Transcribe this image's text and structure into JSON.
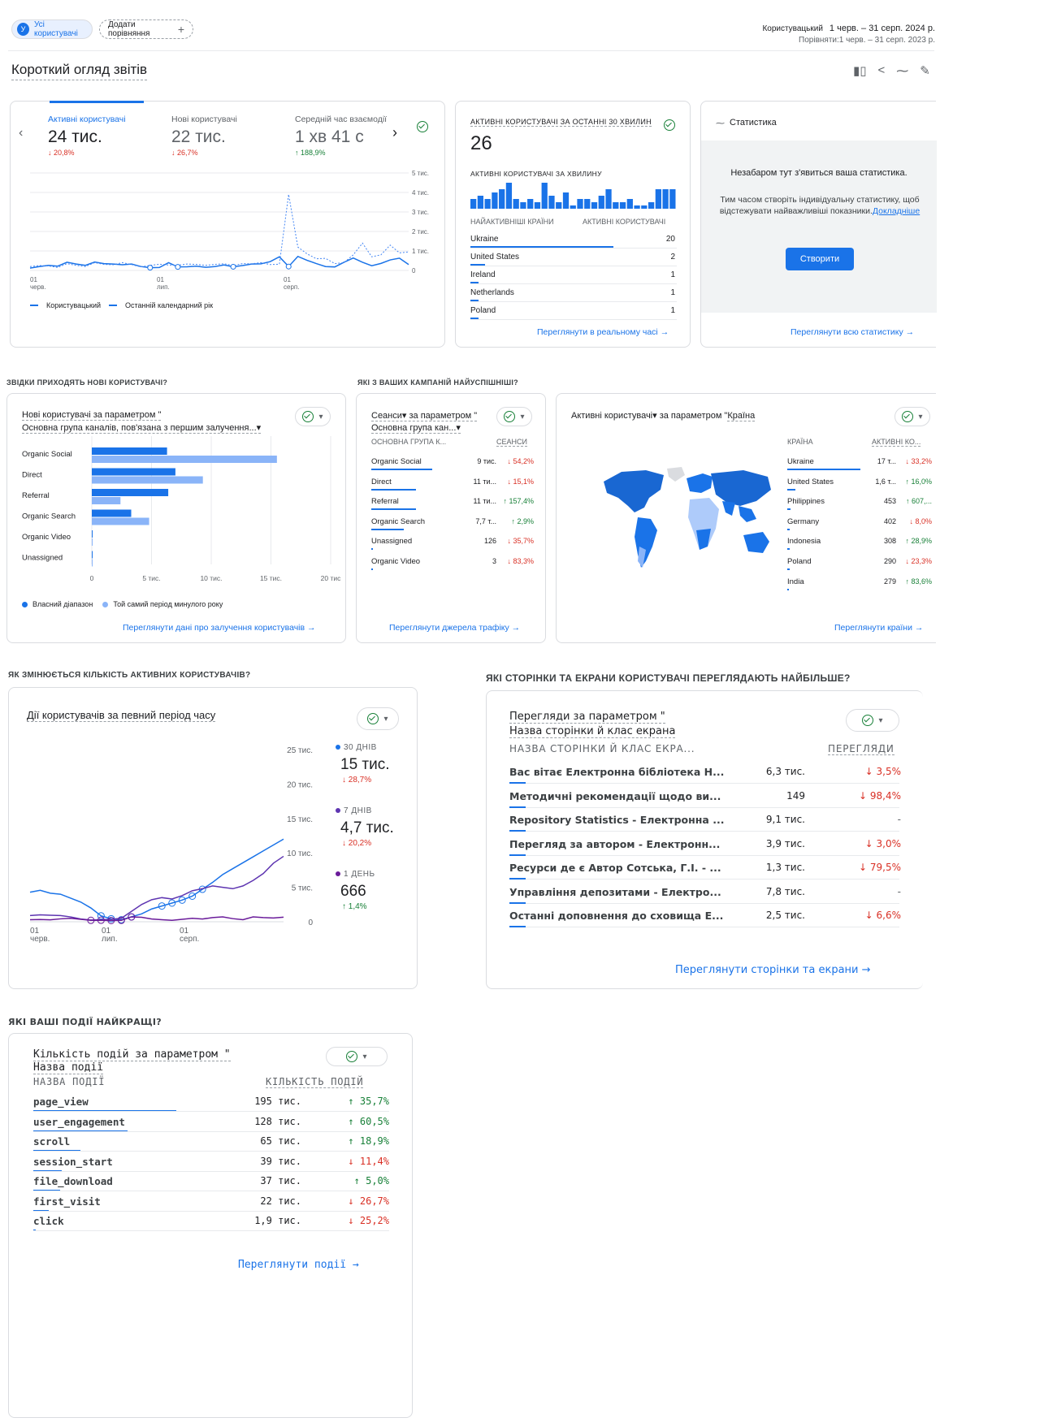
{
  "header": {
    "chip_all": "Усі користувачі",
    "chip_avatar": "У",
    "add_compare": "Додати порівняння",
    "range_label": "Користувацький",
    "range": "1 черв. – 31 серп. 2024 р.",
    "compare": "Порівняти:1 черв. – 31 серп. 2023 р.",
    "page_title": "Короткий огляд звітів"
  },
  "overview": {
    "metrics": [
      {
        "label": "Активні користувачі",
        "value": "24 тис.",
        "delta": "↓ 20,8%",
        "dir": "down"
      },
      {
        "label": "Нові користувачі",
        "value": "22 тис.",
        "delta": "↓ 26,7%",
        "dir": "down"
      },
      {
        "label": "Середній час взаємодії",
        "value": "1 хв 41 с",
        "delta": "↑ 188,9%",
        "dir": "up"
      }
    ],
    "y_ticks": [
      "5 тис.",
      "4 тис.",
      "3 тис.",
      "2 тис.",
      "1 тис.",
      "0"
    ],
    "x_ticks": [
      {
        "d": "01",
        "m": "черв."
      },
      {
        "d": "01",
        "m": "лип."
      },
      {
        "d": "01",
        "m": "серп."
      }
    ],
    "legend": [
      "Користувацький",
      "Останній календарний рік"
    ]
  },
  "realtime": {
    "title": "АКТИВНІ КОРИСТУВАЧІ ЗА ОСТАННІ 30 ХВИЛИН",
    "value": "26",
    "per_min": "АКТИВНІ КОРИСТУВАЧІ ЗА ХВИЛИНУ",
    "col1": "НАЙАКТИВНІШІ КРАЇНИ",
    "col2": "АКТИВНІ КОРИСТУВАЧІ",
    "rows": [
      {
        "name": "Ukraine",
        "v": "20",
        "share": 0.9
      },
      {
        "name": "United States",
        "v": "2",
        "share": 0.09
      },
      {
        "name": "Ireland",
        "v": "1",
        "share": 0.05
      },
      {
        "name": "Netherlands",
        "v": "1",
        "share": 0.05
      },
      {
        "name": "Poland",
        "v": "1",
        "share": 0.05
      }
    ],
    "link": "Переглянути в реальному часі"
  },
  "insights": {
    "title": "Статистика",
    "headline": "Незабаром тут з'явиться ваша статистика.",
    "body": "Тим часом створіть індивідуальну статистику, щоб відстежувати найважливіші показники.",
    "more": "Докладніше",
    "button": "Створити",
    "link": "Переглянути всю статистику"
  },
  "sections": {
    "s1": "ЗВІДКИ ПРИХОДЯТЬ НОВІ КОРИСТУВАЧІ?",
    "s2": "ЯКІ З ВАШИХ КАМПАНІЙ НАЙУСПІШНІШІ?",
    "s3": "ЯК ЗМІНЮЄТЬСЯ КІЛЬКІСТЬ АКТИВНИХ КОРИСТУВАЧІВ?",
    "s4": "ЯКІ СТОРІНКИ ТА ЕКРАНИ КОРИСТУВАЧІ ПЕРЕГЛЯДАЮТЬ НАЙБІЛЬШЕ?",
    "s5": "ЯКІ ВАШІ ПОДІЇ НАЙКРАЩІ?"
  },
  "newusers": {
    "title1": "Нові користувачі за параметром \"",
    "title2": "Основна група каналів, пов'язана з першим залучення...▾",
    "legend": [
      "Власний діапазон",
      "Той самий період минулого року"
    ],
    "link": "Переглянути дані про залучення користувачів"
  },
  "sessions": {
    "title1": "Сеанси▾ за параметром \"",
    "title2": "Основна група кан...▾",
    "col1": "ОСНОВНА ГРУПА К...",
    "col2": "СЕАНСИ",
    "rows": [
      {
        "name": "Organic Social",
        "v": "9 тис.",
        "d": "↓ 54,2%",
        "dir": "down",
        "share": 0.75
      },
      {
        "name": "Direct",
        "v": "11 ти...",
        "d": "↓ 15,1%",
        "dir": "down",
        "share": 0.55
      },
      {
        "name": "Referral",
        "v": "11 ти...",
        "d": "↑ 157,4%",
        "dir": "up",
        "share": 0.55
      },
      {
        "name": "Organic Search",
        "v": "7,7 т...",
        "d": "↑ 2,9%",
        "dir": "up",
        "share": 0.4
      },
      {
        "name": "Unassigned",
        "v": "126",
        "d": "↓ 35,7%",
        "dir": "down",
        "share": 0.02
      },
      {
        "name": "Organic Video",
        "v": "3",
        "d": "↓ 83,3%",
        "dir": "down",
        "share": 0.01
      }
    ],
    "link": "Переглянути джерела трафіку"
  },
  "countries": {
    "title1": "Активні користувачі▾ за параметром \"",
    "title2": "Країна",
    "col1": "КРАЇНА",
    "col2": "АКТИВНІ КО...",
    "rows": [
      {
        "name": "Ukraine",
        "v": "17 т...",
        "d": "↓ 33,2%",
        "dir": "down",
        "share": 0.9
      },
      {
        "name": "United States",
        "v": "1,6 т...",
        "d": "↑ 16,0%",
        "dir": "up",
        "share": 0.1
      },
      {
        "name": "Philippines",
        "v": "453",
        "d": "↑ 607,...",
        "dir": "up",
        "share": 0.04
      },
      {
        "name": "Germany",
        "v": "402",
        "d": "↓ 8,0%",
        "dir": "down",
        "share": 0.03
      },
      {
        "name": "Indonesia",
        "v": "308",
        "d": "↑ 28,9%",
        "dir": "up",
        "share": 0.03
      },
      {
        "name": "Poland",
        "v": "290",
        "d": "↓ 23,3%",
        "dir": "down",
        "share": 0.03
      },
      {
        "name": "India",
        "v": "279",
        "d": "↑ 83,6%",
        "dir": "up",
        "share": 0.02
      }
    ],
    "link": "Переглянути країни"
  },
  "activity": {
    "title": "Дії користувачів за певний період часу",
    "y_ticks": [
      "25 тис.",
      "20 тис.",
      "15 тис.",
      "10 тис.",
      "5 тис.",
      "0"
    ],
    "x_ticks": [
      {
        "d": "01",
        "m": "черв."
      },
      {
        "d": "01",
        "m": "лип."
      },
      {
        "d": "01",
        "m": "серп."
      }
    ],
    "stats": [
      {
        "label": "30 ДНІВ",
        "value": "15 тис.",
        "d": "↓ 28,7%",
        "dir": "down",
        "color": "#1a73e8"
      },
      {
        "label": "7 ДНІВ",
        "value": "4,7 тис.",
        "d": "↓ 20,2%",
        "dir": "down",
        "color": "#5e35b1"
      },
      {
        "label": "1 ДЕНЬ",
        "value": "666",
        "d": "↑ 1,4%",
        "dir": "up",
        "color": "#6a1b9a"
      }
    ]
  },
  "pages": {
    "title1": "Перегляди за параметром \"",
    "title2": "Назва сторінки й клас екрана",
    "col1": "НАЗВА СТОРІНКИ Й КЛАС ЕКРА...",
    "col2": "ПЕРЕГЛЯДИ",
    "rows": [
      {
        "name": "Вас вітає Електронна бібліотека Н...",
        "v": "6,3 тис.",
        "d": "↓ 3,5%",
        "dir": "down"
      },
      {
        "name": "Методичні рекомендації щодо ви...",
        "v": "149",
        "d": "↓ 98,4%",
        "dir": "down"
      },
      {
        "name": "Repository Statistics - Електронна ...",
        "v": "9,1 тис.",
        "d": "-",
        "dir": "none"
      },
      {
        "name": "Перегляд за автором - Електронн...",
        "v": "3,9 тис.",
        "d": "↓ 3,0%",
        "dir": "down"
      },
      {
        "name": "Ресурси де є Автор Сотська, Г.І. - ...",
        "v": "1,3 тис.",
        "d": "↓ 79,5%",
        "dir": "down"
      },
      {
        "name": "Управління депозитами - Електро...",
        "v": "7,8 тис.",
        "d": "-",
        "dir": "none"
      },
      {
        "name": "Останні доповнення до сховища Е...",
        "v": "2,5 тис.",
        "d": "↓ 6,6%",
        "dir": "down"
      }
    ],
    "link": "Переглянути сторінки та екрани"
  },
  "events": {
    "title1": "Кількість подій за параметром \"",
    "title2": "Назва події",
    "col1": "НАЗВА ПОДІЇ",
    "col2": "КІЛЬКІСТЬ ПОДІЙ",
    "rows": [
      {
        "name": "page_view",
        "v": "195 тис.",
        "d": "↑ 35,7%",
        "dir": "up",
        "share": 1
      },
      {
        "name": "user_engagement",
        "v": "128 тис.",
        "d": "↑ 60,5%",
        "dir": "up",
        "share": 0.66
      },
      {
        "name": "scroll",
        "v": "65 тис.",
        "d": "↑ 18,9%",
        "dir": "up",
        "share": 0.33
      },
      {
        "name": "session_start",
        "v": "39 тис.",
        "d": "↓ 11,4%",
        "dir": "down",
        "share": 0.2
      },
      {
        "name": "file_download",
        "v": "37 тис.",
        "d": "↑ 5,0%",
        "dir": "up",
        "share": 0.19
      },
      {
        "name": "first_visit",
        "v": "22 тис.",
        "d": "↓ 26,7%",
        "dir": "down",
        "share": 0.11
      },
      {
        "name": "click",
        "v": "1,9 тис.",
        "d": "↓ 25,2%",
        "dir": "down",
        "share": 0.01
      }
    ],
    "link": "Переглянути події"
  },
  "chart_data": [
    {
      "type": "bar",
      "categories": [
        "Organic Social",
        "Direct",
        "Referral",
        "Organic Search",
        "Organic Video",
        "Unassigned"
      ],
      "series": [
        {
          "name": "Власний діапазон",
          "values": [
            6300,
            7000,
            6400,
            3300,
            50,
            40
          ]
        },
        {
          "name": "Той самий період минулого року",
          "values": [
            15500,
            9300,
            2400,
            4800,
            60,
            30
          ]
        }
      ],
      "x_ticks": [
        "0",
        "5 тис.",
        "10 тис.",
        "15 тис.",
        "20 тис"
      ],
      "xlim": [
        0,
        20000
      ],
      "orientation": "horizontal"
    },
    {
      "type": "bar",
      "values": [
        3,
        4,
        3,
        5,
        6,
        8,
        3,
        2,
        3,
        2,
        8,
        4,
        2,
        5,
        1,
        3,
        3,
        2,
        4,
        6,
        2,
        2,
        3,
        1,
        1,
        2,
        6,
        6,
        6
      ],
      "ylim": [
        0,
        8
      ]
    },
    {
      "type": "line",
      "ylim": [
        0,
        5000
      ],
      "series": [
        {
          "name": "Користувацький",
          "values": [
            120,
            200,
            260,
            220,
            420,
            330,
            260,
            430,
            350,
            330,
            290,
            330,
            200,
            140,
            150,
            400,
            180,
            190,
            220,
            160,
            200,
            280,
            190,
            250,
            330,
            340,
            450,
            700,
            200,
            720,
            520,
            350,
            200,
            180,
            420,
            640,
            420,
            240,
            360,
            540,
            630,
            300
          ]
        },
        {
          "name": "Останній календарний рік",
          "values": [
            200,
            250,
            230,
            150,
            350,
            260,
            200,
            400,
            310,
            290,
            400,
            300,
            180,
            260,
            320,
            280,
            260,
            330,
            310,
            260,
            310,
            340,
            250,
            350,
            340,
            400,
            300,
            320,
            3900,
            1200,
            850,
            600,
            620,
            350,
            400,
            800,
            1400,
            700,
            800,
            1300,
            900,
            950
          ]
        }
      ]
    },
    {
      "type": "line",
      "ylim": [
        0,
        25000
      ],
      "series": [
        {
          "name": "30 ДНІВ",
          "values": [
            15000,
            16000,
            14500,
            14000,
            12000,
            10000,
            7000,
            3000,
            1500,
            1000,
            2500,
            4000,
            6500,
            8000,
            9500,
            11000,
            13000,
            16500,
            20000,
            24000,
            27000,
            30000,
            33000,
            36000,
            39000,
            42000
          ]
        },
        {
          "name": "7 ДНІВ",
          "values": [
            900,
            1000,
            950,
            900,
            700,
            400,
            250,
            300,
            350,
            500,
            1500,
            2500,
            3200,
            3500,
            3300,
            3800,
            4500,
            4800,
            5200,
            5000,
            4800,
            5200,
            6000,
            7000,
            8500,
            9500
          ]
        },
        {
          "name": "1 ДЕНЬ",
          "values": [
            300,
            320,
            280,
            420,
            500,
            350,
            200,
            220,
            180,
            200,
            700,
            650,
            400,
            300,
            200,
            350,
            500,
            400,
            600,
            700,
            450,
            300,
            700,
            600,
            550,
            660
          ]
        }
      ]
    }
  ]
}
